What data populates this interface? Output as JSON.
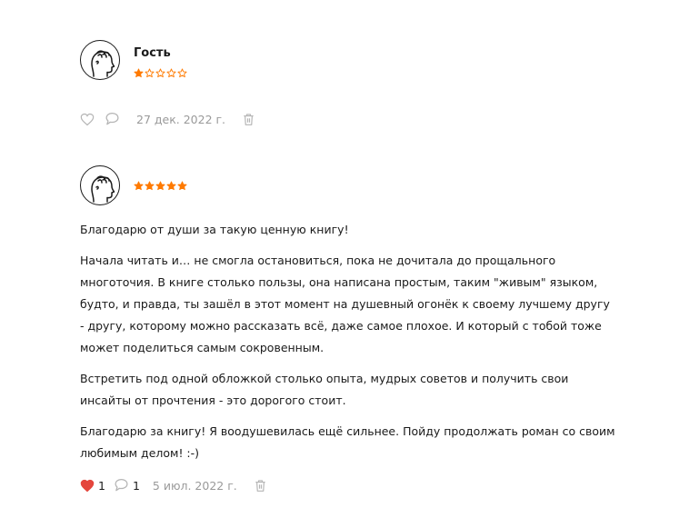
{
  "reviews": [
    {
      "author": "Гость",
      "rating": 1,
      "max_rating": 5,
      "paragraphs": [],
      "liked": false,
      "likes": "",
      "comments": "",
      "date": "27 дек. 2022 г."
    },
    {
      "author": "",
      "rating": 5,
      "max_rating": 5,
      "paragraphs": [
        "Благодарю от души за такую ценную книгу!",
        "Начала читать и… не смогла остановиться, пока не дочитала до прощального многоточия. В книге столько пользы, она написана простым, таким \"живым\" языком, будто, и правда, ты зашёл в этот момент на душевный огонёк к своему лучшему другу - другу, которому можно рассказать всё, даже самое плохое. И который с тобой тоже может поделиться самым сокровенным.",
        "Встретить под одной обложкой столько опыта, мудрых советов и получить свои инсайты от прочтения - это дорогого стоит.",
        "Благодарю за книгу! Я воодушевилась ещё сильнее. Пойду продолжать роман со своим любимым делом! :-)"
      ],
      "liked": true,
      "likes": "1",
      "comments": "1",
      "date": "5 июл. 2022 г."
    }
  ],
  "icons": {
    "avatar": "head-profile-icon",
    "star": "star-icon",
    "like": "heart-icon",
    "comment": "comment-bubble-icon",
    "delete": "trash-icon"
  },
  "colors": {
    "star": "#ff7a00",
    "heart_active": "#e4463d",
    "icon_muted": "#b5b5b5",
    "text": "#1a1a1a",
    "date": "#9a9a9a"
  }
}
